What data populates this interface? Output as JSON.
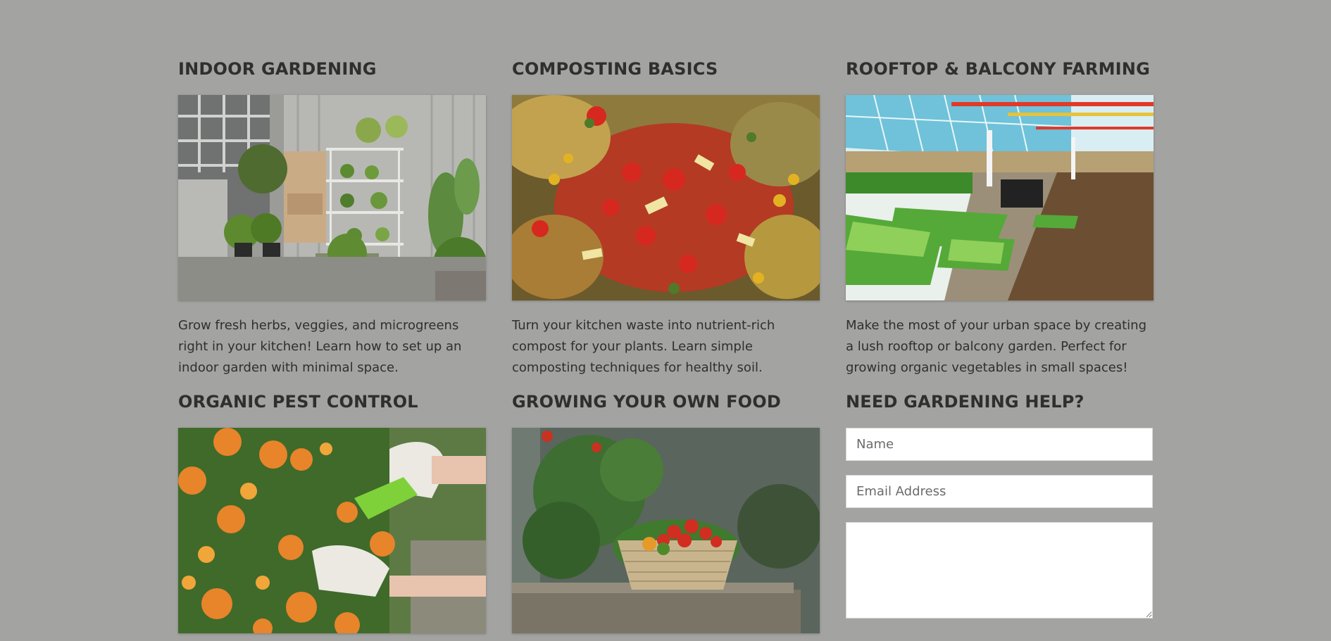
{
  "cards": [
    {
      "title": "INDOOR GARDENING",
      "description": "Grow fresh herbs, veggies, and microgreens right in your kitchen! Learn how to set up an indoor garden with minimal space.",
      "image": "indoor-garden-shelves-photo"
    },
    {
      "title": "COMPOSTING BASICS",
      "description": "Turn your kitchen waste into nutrient-rich compost for your plants. Learn simple composting techniques for healthy soil.",
      "image": "compost-pile-photo"
    },
    {
      "title": "ROOFTOP & BALCONY FARMING",
      "description": "Make the most of your urban space by creating a lush rooftop or balcony garden. Perfect for growing organic vegetables in small spaces!",
      "image": "rooftop-greenhouse-photo"
    },
    {
      "title": "ORGANIC PEST CONTROL",
      "image": "marigold-pruning-photo"
    },
    {
      "title": "GROWING YOUR OWN FOOD",
      "image": "tomato-basket-photo"
    }
  ],
  "help_form": {
    "title": "NEED GARDENING HELP?",
    "name_placeholder": "Name",
    "email_placeholder": "Email Address",
    "message_placeholder": ""
  },
  "colors": {
    "page_background": "#a3a3a1",
    "heading_text": "#2f2f2f",
    "field_background": "#ffffff"
  }
}
